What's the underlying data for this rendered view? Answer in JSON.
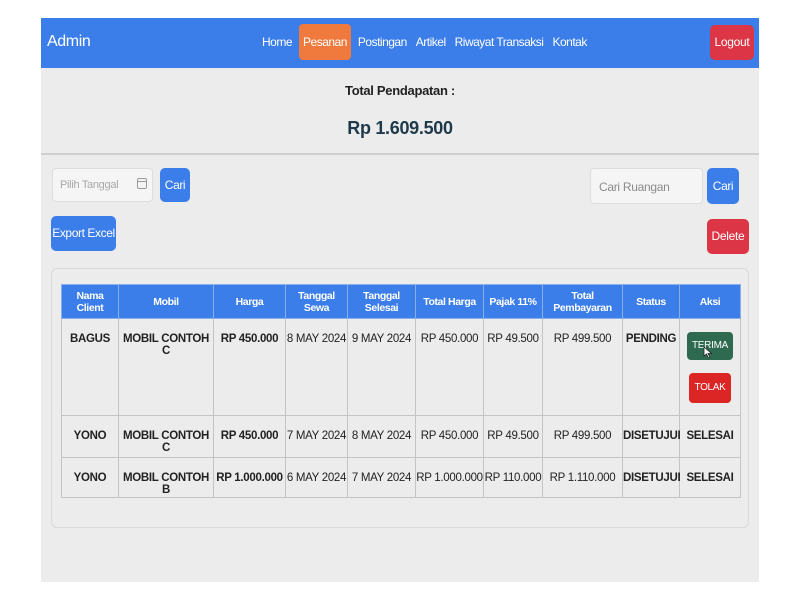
{
  "navbar": {
    "brand": "Admin",
    "links": [
      "Home",
      "Pesanan",
      "Postingan",
      "Artikel",
      "Riwayat Transaksi",
      "Kontak"
    ],
    "active_index": 1,
    "logout_label": "Logout"
  },
  "summary": {
    "label": "Total Pendapatan :",
    "amount": "Rp 1.609.500"
  },
  "filters": {
    "date_placeholder": "Pilih Tanggal",
    "search_label": "Cari",
    "room_placeholder": "Cari Ruangan",
    "room_search_label": "Cari",
    "export_label": "Export Excel",
    "delete_label": "Delete",
    "calendar_icon": "calendar-icon"
  },
  "table": {
    "headers": [
      "Nama Client",
      "Mobil",
      "Harga",
      "Tanggal Sewa",
      "Tanggal Selesai",
      "Total Harga",
      "Pajak 11%",
      "Total Pembayaran",
      "Status",
      "Aksi"
    ],
    "rows": [
      {
        "client": "BAGUS",
        "car": "MOBIL CONTOH C",
        "price": "RP 450.000",
        "start": "8 MAY 2024",
        "end": "9 MAY 2024",
        "total": "RP 450.000",
        "tax": "RP 49.500",
        "payment": "RP 499.500",
        "status": "PENDING",
        "accept_label": "TERIMA",
        "reject_label": "TOLAK"
      },
      {
        "client": "YONO",
        "car": "MOBIL CONTOH C",
        "price": "RP 450.000",
        "start": "7 MAY 2024",
        "end": "8 MAY 2024",
        "total": "RP 450.000",
        "tax": "RP 49.500",
        "payment": "RP 499.500",
        "status": "DISETUJUI",
        "action": "SELESAI"
      },
      {
        "client": "YONO",
        "car": "MOBIL CONTOH B",
        "price": "RP 1.000.000",
        "start": "6 MAY 2024",
        "end": "7 MAY 2024",
        "total": "RP 1.000.000",
        "tax": "RP 110.000",
        "payment": "RP 1.110.000",
        "status": "DISETUJUI",
        "action": "SELESAI"
      }
    ]
  },
  "colors": {
    "primary": "#3b7de9",
    "active_nav": "#f07a3e",
    "danger": "#dc3545",
    "accept": "#2d6a4f",
    "pending": "#f0a01a",
    "approved": "#2a8a3a"
  }
}
